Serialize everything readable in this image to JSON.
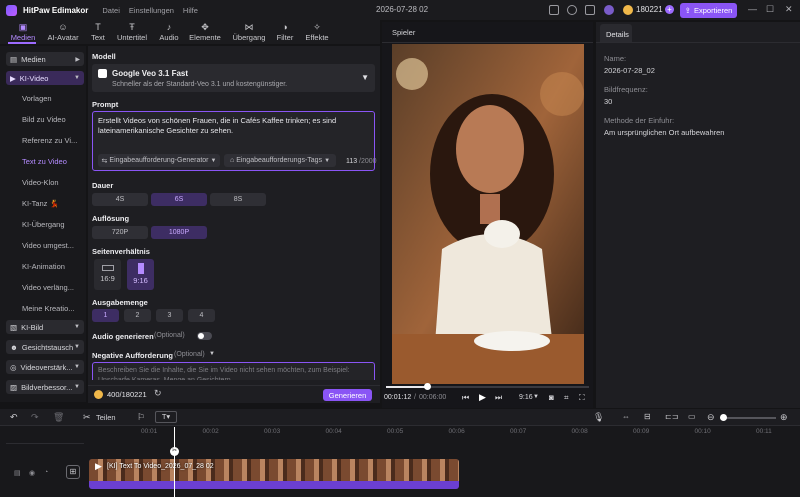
{
  "app": {
    "name": "HitPaw Edimakor",
    "menu": [
      "Datei",
      "Einstellungen",
      "Hilfe"
    ],
    "document_title": "2026-07-28 02",
    "credits": "180221",
    "export_label": "Exportieren"
  },
  "toolbar": {
    "tools": [
      {
        "label": "Medien",
        "icon": "media-icon",
        "active": true
      },
      {
        "label": "AI-Avatar",
        "icon": "avatar-icon"
      },
      {
        "label": "Text",
        "icon": "text-icon"
      },
      {
        "label": "Untertitel",
        "icon": "subtitle-icon"
      },
      {
        "label": "Audio",
        "icon": "music-note-icon"
      },
      {
        "label": "Elemente",
        "icon": "elements-icon"
      },
      {
        "label": "Übergang",
        "icon": "transition-icon"
      },
      {
        "label": "Filter",
        "icon": "filter-icon"
      },
      {
        "label": "Effekte",
        "icon": "effects-icon"
      }
    ]
  },
  "sidebar": {
    "medien": "Medien",
    "ki_video": "KI-Video",
    "ki_video_items": [
      "Vorlagen",
      "Bild zu Video",
      "Referenz zu Vi...",
      "Text zu Video",
      "Video-Klon",
      "KI-Tanz 💃",
      "KI-Übergang",
      "Video umgest...",
      "KI-Animation",
      "Video verläng...",
      "Meine Kreatio..."
    ],
    "selected_item": "Text zu Video",
    "groups": [
      "KI-Bild",
      "Gesichtstausch",
      "Videoverstärk...",
      "Bildverbessor..."
    ]
  },
  "panel": {
    "model_label": "Modell",
    "model_name": "Google Veo 3.1 Fast",
    "model_desc": "Schneller als der Standard-Veo 3.1 und kostengünstiger.",
    "prompt_label": "Prompt",
    "prompt_text": "Erstellt Videos von schönen Frauen, die in Cafés Kaffee trinken; es sind lateinamerikanische Gesichter zu sehen.",
    "prompt_generator": "Eingabeaufforderung-Generator",
    "prompt_tags": "Eingabeaufforderungs-Tags",
    "char_count": "113",
    "char_max": "/2000",
    "duration_label": "Dauer",
    "durations": [
      "4S",
      "6S",
      "8S"
    ],
    "duration_selected": "6S",
    "resolution_label": "Auflösung",
    "resolutions": [
      "720P",
      "1080P"
    ],
    "resolution_selected": "1080P",
    "ratio_label": "Seitenverhältnis",
    "ratios": [
      "16:9",
      "9:16"
    ],
    "ratio_selected": "9:16",
    "count_label": "Ausgabemenge",
    "counts": [
      "1",
      "2",
      "3",
      "4"
    ],
    "count_selected": "1",
    "audio_label": "Audio generieren",
    "audio_optional": "(Optional)",
    "neg_label": "Negative Aufforderung",
    "neg_optional": "(Optional)",
    "neg_placeholder": "Beschreiben Sie die Inhalte, die Sie im Video nicht sehen möchten, zum Beispiel: Unscharfe Kameras, Menge an Gesichtern...",
    "cost": "400/180221",
    "generate_label": "Generieren"
  },
  "player": {
    "tab": "Spieler",
    "time_current": "00:01:12",
    "time_total": "00:06:00",
    "aspect": "9:16",
    "progress": 0.2
  },
  "details": {
    "tab": "Details",
    "name_label": "Name:",
    "name_value": "2026-07-28_02",
    "fps_label": "Bildfrequenz:",
    "fps_value": "30",
    "insert_label": "Methode der Einfuhr:",
    "insert_value": "Am ursprünglichen Ort aufbewahren"
  },
  "timeline": {
    "split_label": "Teilen",
    "ruler": [
      "00:01",
      "00:02",
      "00:03",
      "00:04",
      "00:05",
      "00:06",
      "00:07",
      "00:08",
      "00:09",
      "00:10",
      "00:11"
    ],
    "clip_label": "[KI] Text To Video_2026_07_28 02"
  },
  "colors": {
    "accent": "#8a55f5",
    "accent_light": "#b48bff",
    "bg": "#141416",
    "panel": "#1e1e22"
  }
}
